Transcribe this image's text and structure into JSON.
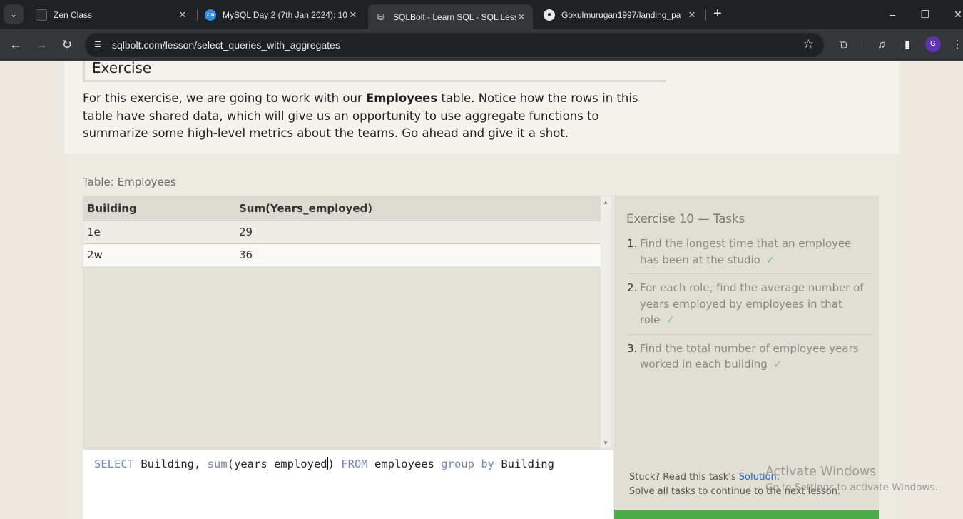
{
  "browser": {
    "tabs": [
      {
        "title": "Zen Class",
        "active": false
      },
      {
        "title": "MySQL Day 2 (7th Jan 2024): 10",
        "active": false
      },
      {
        "title": "SQLBolt - Learn SQL - SQL Less",
        "active": true
      },
      {
        "title": "Gokulmurugan1997/landing_pa",
        "active": false
      }
    ],
    "url": "sqlbolt.com/lesson/select_queries_with_aggregates",
    "profile_initial": "G",
    "favicon_zoom_text": "zm"
  },
  "exercise": {
    "heading": "Exercise",
    "intro_before": "For this exercise, we are going to work with our ",
    "intro_bold": "Employees",
    "intro_after": " table. Notice how the rows in this table have shared data, which will give us an opportunity to use aggregate functions to summarize some high-level metrics about the teams. Go ahead and give it a shot."
  },
  "result": {
    "caption": "Table: Employees",
    "columns": [
      "Building",
      "Sum(Years_employed)"
    ],
    "rows": [
      [
        "1e",
        "29"
      ],
      [
        "2w",
        "36"
      ]
    ]
  },
  "editor": {
    "tokens": [
      {
        "text": "SELECT",
        "type": "keyword"
      },
      {
        "text": " Building, ",
        "type": "plain"
      },
      {
        "text": "sum",
        "type": "keyword"
      },
      {
        "text": "(years_employed",
        "type": "plain"
      },
      {
        "text": ") ",
        "type": "plain"
      },
      {
        "text": "FROM",
        "type": "keyword"
      },
      {
        "text": " employees ",
        "type": "plain"
      },
      {
        "text": "group",
        "type": "keyword"
      },
      {
        "text": " ",
        "type": "plain"
      },
      {
        "text": "by",
        "type": "keyword"
      },
      {
        "text": " Building",
        "type": "plain"
      }
    ]
  },
  "tasks": {
    "title": "Exercise 10 — Tasks",
    "items": [
      {
        "num": "1.",
        "text": "Find the longest time that an employee has been at the studio",
        "check": "✓"
      },
      {
        "num": "2.",
        "text": "For each role, find the average number of years employed by employees in that role",
        "check": "✓"
      },
      {
        "num": "3.",
        "text": "Find the total number of employee years worked in each building",
        "check": "✓"
      }
    ],
    "stuck_prefix": "Stuck? Read this task's ",
    "solution_link": "Solution",
    "stuck_suffix": ".",
    "continue_note": "Solve all tasks to continue to the next lesson."
  },
  "watermark": {
    "line1": "Activate Windows",
    "line2": "Go to Settings to activate Windows."
  },
  "colors": {
    "keyword": "#7287b6",
    "continue": "#4aad4a",
    "check": "#7ec47e",
    "link": "#2266cc"
  }
}
